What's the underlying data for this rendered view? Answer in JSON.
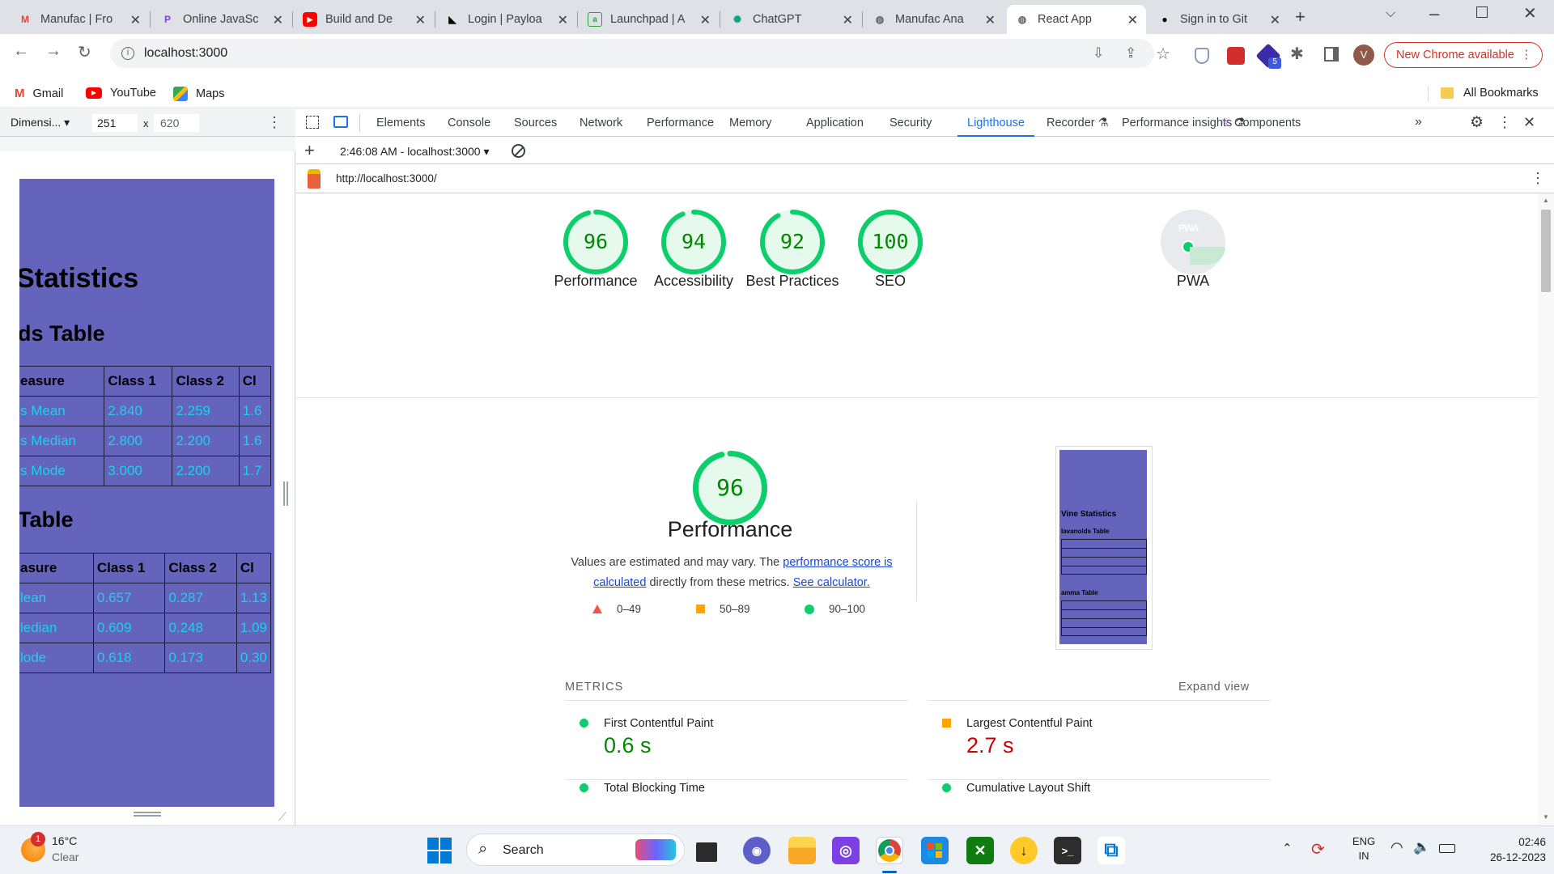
{
  "browser": {
    "tabs": [
      {
        "title": "Manufac | Fro",
        "icon": "gmail-icon",
        "color": "#ea4335"
      },
      {
        "title": "Online JavaSc",
        "icon": "p-icon",
        "color": "#7b3fe4"
      },
      {
        "title": "Build and De",
        "icon": "youtube-icon",
        "color": "#ff0000"
      },
      {
        "title": "Login | Payloa",
        "icon": "payload-icon",
        "color": "#000000"
      },
      {
        "title": "Launchpad | A",
        "icon": "alt-icon",
        "color": "#2e9e44"
      },
      {
        "title": "ChatGPT",
        "icon": "chatgpt-icon",
        "color": "#10a37f"
      },
      {
        "title": "Manufac Ana",
        "icon": "globe-icon",
        "color": "#5f6368"
      },
      {
        "title": "React App",
        "icon": "globe-icon",
        "color": "#5f6368"
      },
      {
        "title": "Sign in to Git",
        "icon": "github-icon",
        "color": "#000000"
      }
    ],
    "url": "localhost:3000",
    "update_label": "New Chrome available",
    "profile_initial": "V",
    "extension_badge": "5",
    "bookmarks": [
      {
        "label": "Gmail",
        "icon": "gmail-icon"
      },
      {
        "label": "YouTube",
        "icon": "youtube-icon"
      },
      {
        "label": "Maps",
        "icon": "maps-icon"
      }
    ],
    "all_bookmarks": "All Bookmarks"
  },
  "device_toolbar": {
    "dimensions_label": "Dimensi...",
    "width": "251",
    "height": "620",
    "times": "x"
  },
  "preview_page": {
    "heading": "Statistics",
    "table1_title": "ds Table",
    "table1_headers": [
      "easure",
      "Class 1",
      "Class 2",
      "Cl"
    ],
    "table1_rows": [
      [
        "s Mean",
        "2.840",
        "2.259",
        "1.6"
      ],
      [
        "s Median",
        "2.800",
        "2.200",
        "1.6"
      ],
      [
        "s Mode",
        "3.000",
        "2.200",
        "1.7"
      ]
    ],
    "table2_title": "Table",
    "table2_headers": [
      "asure",
      "Class 1",
      "Class 2",
      "Cl"
    ],
    "table2_rows": [
      [
        "lean",
        "0.657",
        "0.287",
        "1.13"
      ],
      [
        "ledian",
        "0.609",
        "0.248",
        "1.09"
      ],
      [
        "lode",
        "0.618",
        "0.173",
        "0.30"
      ]
    ]
  },
  "devtools": {
    "tabs": [
      "Elements",
      "Console",
      "Sources",
      "Network",
      "Performance",
      "Memory",
      "Application",
      "Security",
      "Lighthouse",
      "Recorder",
      "Performance insights",
      "Components"
    ],
    "active_tab": "Lighthouse",
    "report_time": "2:46:08 AM - localhost:3000",
    "report_url": "http://localhost:3000/"
  },
  "lighthouse": {
    "scores": [
      {
        "value": "96",
        "label": "Performance",
        "fraction": 0.96
      },
      {
        "value": "94",
        "label": "Accessibility",
        "fraction": 0.94
      },
      {
        "value": "92",
        "label": "Best Practices",
        "fraction": 0.92
      },
      {
        "value": "100",
        "label": "SEO",
        "fraction": 1.0
      }
    ],
    "pwa_label": "PWA",
    "pwa_badge": "PWA",
    "main_score": "96",
    "main_fraction": 0.96,
    "main_title": "Performance",
    "desc_prefix": "Values are estimated and may vary. The ",
    "desc_link1": "performance score is calculated",
    "desc_mid": " directly from these metrics. ",
    "desc_link2": "See calculator.",
    "legend": [
      {
        "range": "0–49",
        "color": "#ff4e42",
        "shape": "triangle"
      },
      {
        "range": "50–89",
        "color": "#ffa400",
        "shape": "square"
      },
      {
        "range": "90–100",
        "color": "#0cce6b",
        "shape": "circle"
      }
    ],
    "screenshot": {
      "heading": "Vine Statistics",
      "sub1": "lavanoids Table",
      "sub2": "amma Table"
    },
    "metrics_title": "METRICS",
    "expand_label": "Expand view",
    "metrics": [
      {
        "name": "First Contentful Paint",
        "value": "0.6 s",
        "status": "good"
      },
      {
        "name": "Largest Contentful Paint",
        "value": "2.7 s",
        "status": "poor"
      },
      {
        "name": "Total Blocking Time",
        "value": "",
        "status": "good"
      },
      {
        "name": "Cumulative Layout Shift",
        "value": "",
        "status": "good"
      }
    ],
    "colors": {
      "good": "#0cce6b",
      "good_text": "#008800",
      "avg": "#ffa400",
      "poor_text": "#cc0000",
      "ring_bg": "#e6f9ed",
      "link": "#1a47d6"
    }
  },
  "taskbar": {
    "weather_temp": "16°C",
    "weather_desc": "Clear",
    "weather_badge": "1",
    "search_label": "Search",
    "lang": "ENG",
    "region": "IN",
    "time": "02:46",
    "date": "26-12-2023",
    "apps": [
      "windows-start-icon",
      "search-icon",
      "task-view-icon",
      "teams-chat-icon",
      "file-explorer-icon",
      "app-icon",
      "chrome-icon",
      "store-icon",
      "xbox-icon",
      "download-icon",
      "terminal-icon",
      "vscode-icon"
    ]
  }
}
